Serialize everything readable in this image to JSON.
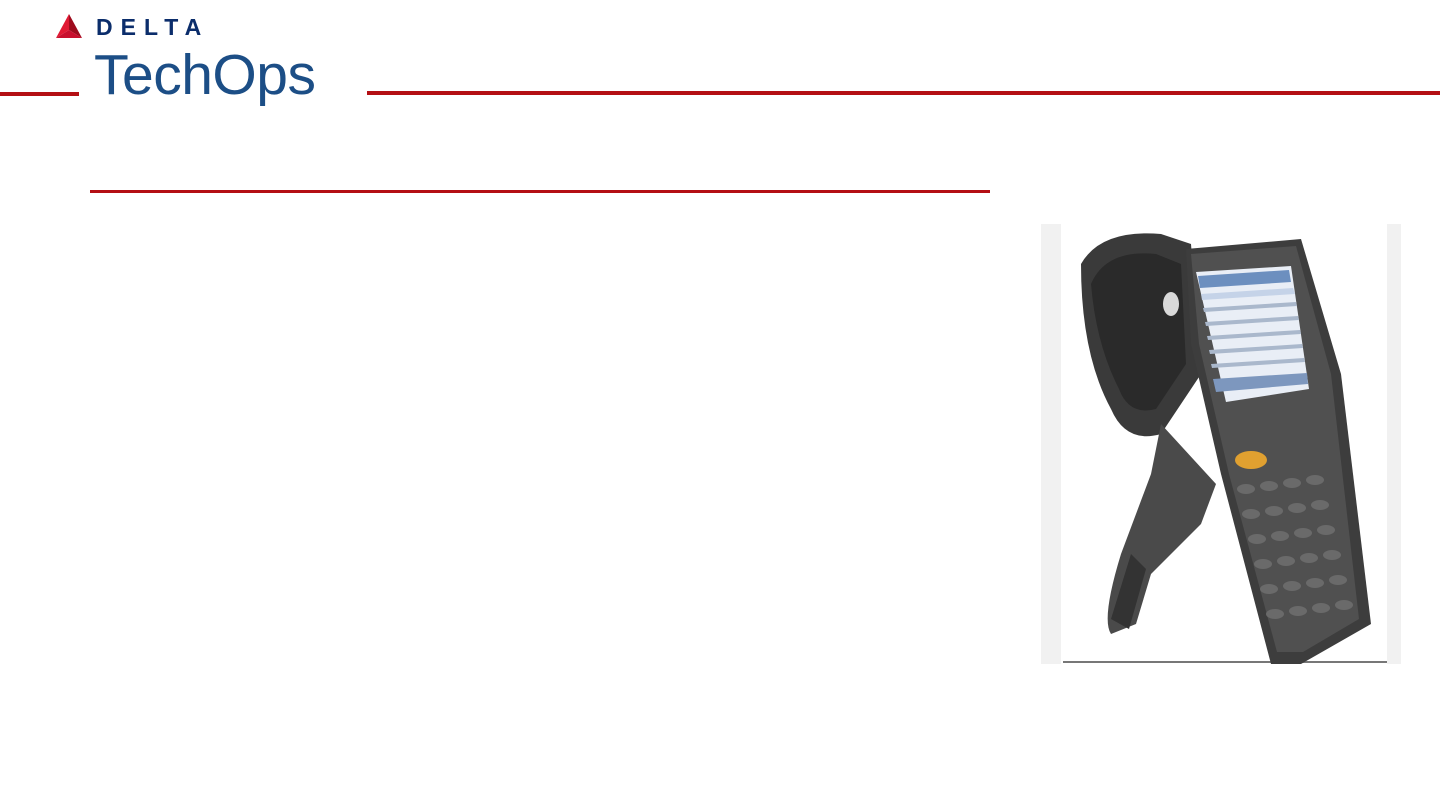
{
  "header": {
    "brand_text": "DELTA",
    "sub_text": "TechOps",
    "logo_icon": "delta-widget-icon",
    "accent_color": "#b40f14",
    "brand_color": "#0b2d6b"
  },
  "media": {
    "device_image": "handheld-rfid-scanner-image"
  }
}
